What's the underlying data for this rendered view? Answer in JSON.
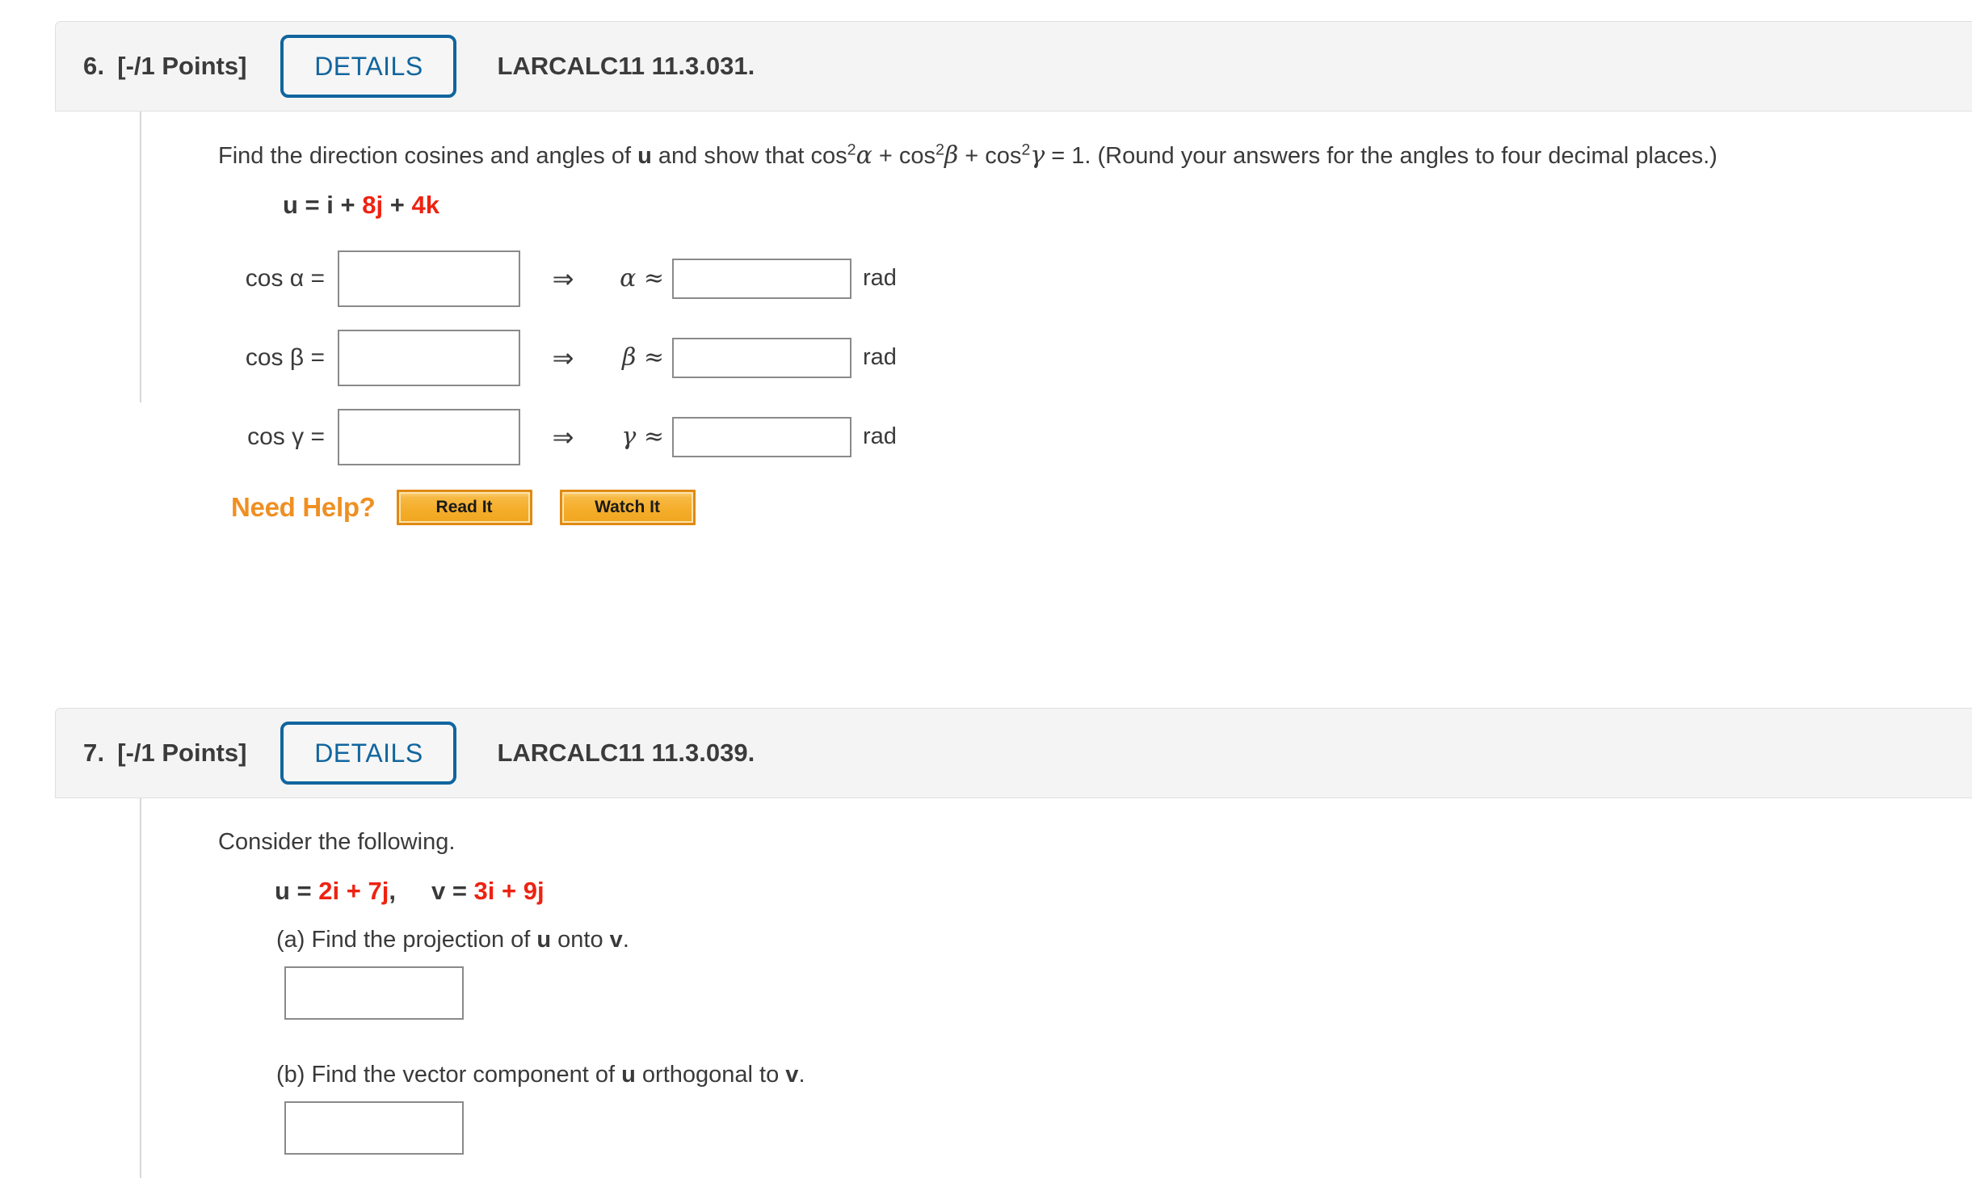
{
  "questions": [
    {
      "number": "6.",
      "points": "[-/1 Points]",
      "details_label": "DETAILS",
      "code": "LARCALC11 11.3.031.",
      "prompt": {
        "part1": "Find the direction cosines and angles of ",
        "bold_u": "u",
        "part2": " and show that  cos",
        "sup1": "2",
        "alpha": "α",
        "plus1": " + cos",
        "sup2": "2",
        "beta": "β",
        "plus2": " + cos",
        "sup3": "2",
        "gamma": "γ",
        "tail": " = 1.  (Round your answers for the angles to four decimal places.)"
      },
      "vector": {
        "u": "u",
        "eq": " = ",
        "i": "i",
        "plus1": " + ",
        "coef_j": "8",
        "j": "j",
        "plus2": " + ",
        "coef_k": "4",
        "k": "k"
      },
      "rows": [
        {
          "lhs": "cos α  =",
          "cos_value": "",
          "implies": "⇒",
          "angle": "α ≈",
          "angle_value": "",
          "unit": "rad"
        },
        {
          "lhs": "cos β  =",
          "cos_value": "",
          "implies": "⇒",
          "angle": "β ≈",
          "angle_value": "",
          "unit": "rad"
        },
        {
          "lhs": "cos γ  =",
          "cos_value": "",
          "implies": "⇒",
          "angle": "γ ≈",
          "angle_value": "",
          "unit": "rad"
        }
      ],
      "need_help": {
        "label": "Need Help?",
        "read_it": "Read It",
        "watch_it": "Watch It"
      }
    },
    {
      "number": "7.",
      "points": "[-/1 Points]",
      "details_label": "DETAILS",
      "code": "LARCALC11 11.3.039.",
      "consider": "Consider the following.",
      "vectors": {
        "u": "u",
        "u_eq": " = ",
        "u_terms": "2i + 7j",
        "comma": ",",
        "v": "v",
        "v_eq": " = ",
        "v_terms": "3i + 9j"
      },
      "part_a": {
        "prefix": "(a) Find the projection of ",
        "u": "u",
        "mid": " onto ",
        "v": "v",
        "suffix": ".",
        "value": ""
      },
      "part_b": {
        "prefix": "(b) Find the vector component of ",
        "u": "u",
        "mid": " orthogonal to ",
        "v": "v",
        "suffix": ".",
        "value": ""
      }
    }
  ],
  "colors": {
    "accent_blue": "#11659e",
    "red": "#ee2211",
    "orange": "#ef8f22",
    "header_bg": "#f4f4f4"
  }
}
